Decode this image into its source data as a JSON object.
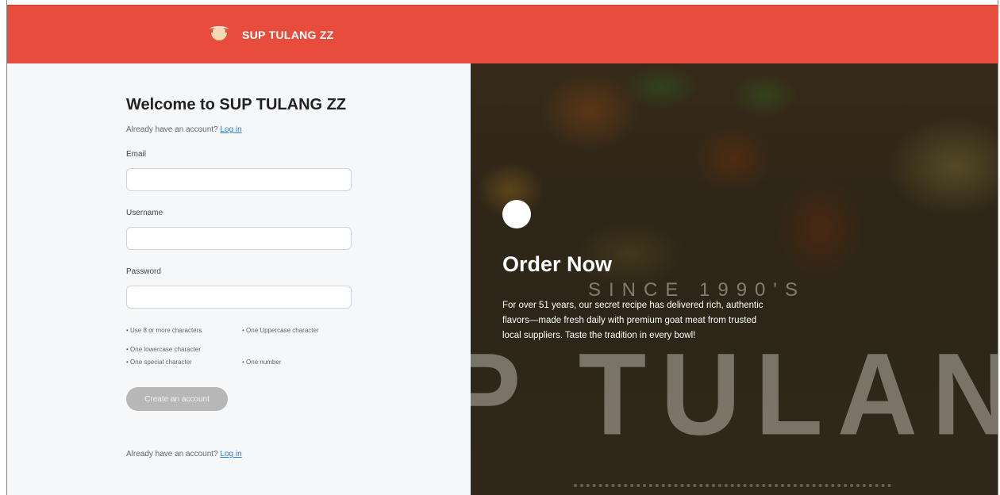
{
  "brand": {
    "name": "SUP TULANG ZZ",
    "color": "#e74c3c",
    "logo_icon": "soup-bowl-logo"
  },
  "form": {
    "title": "Welcome to SUP TULANG ZZ",
    "already_text": "Already have an account?",
    "login_link": "Log in",
    "email_label": "Email",
    "username_label": "Username",
    "password_label": "Password",
    "rules": [
      "• Use 8 or more characters",
      "• One Uppercase character",
      "• One lowercase character",
      "• One special character",
      "• One number"
    ],
    "create_button": "Create an account",
    "bottom_text": "Already have an account?",
    "bottom_link": "Log in"
  },
  "hero": {
    "title": "Order Now",
    "description": "For over 51 years, our secret recipe has delivered rich, authentic flavors—made fresh daily with premium goat meat from trusted local suppliers. Taste the tradition in every bowl!",
    "bg_since": "SINCE 1990'S",
    "bg_word": "P TULANG"
  }
}
